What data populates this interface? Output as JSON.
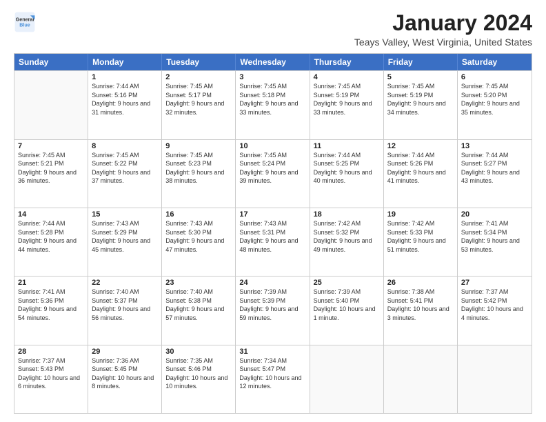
{
  "logo": {
    "line1": "General",
    "line2": "Blue"
  },
  "header": {
    "title": "January 2024",
    "location": "Teays Valley, West Virginia, United States"
  },
  "weekdays": [
    "Sunday",
    "Monday",
    "Tuesday",
    "Wednesday",
    "Thursday",
    "Friday",
    "Saturday"
  ],
  "weeks": [
    [
      {
        "day": "",
        "sunrise": "",
        "sunset": "",
        "daylight": ""
      },
      {
        "day": "1",
        "sunrise": "7:44 AM",
        "sunset": "5:16 PM",
        "daylight": "9 hours and 31 minutes."
      },
      {
        "day": "2",
        "sunrise": "7:45 AM",
        "sunset": "5:17 PM",
        "daylight": "9 hours and 32 minutes."
      },
      {
        "day": "3",
        "sunrise": "7:45 AM",
        "sunset": "5:18 PM",
        "daylight": "9 hours and 33 minutes."
      },
      {
        "day": "4",
        "sunrise": "7:45 AM",
        "sunset": "5:19 PM",
        "daylight": "9 hours and 33 minutes."
      },
      {
        "day": "5",
        "sunrise": "7:45 AM",
        "sunset": "5:19 PM",
        "daylight": "9 hours and 34 minutes."
      },
      {
        "day": "6",
        "sunrise": "7:45 AM",
        "sunset": "5:20 PM",
        "daylight": "9 hours and 35 minutes."
      }
    ],
    [
      {
        "day": "7",
        "sunrise": "7:45 AM",
        "sunset": "5:21 PM",
        "daylight": "9 hours and 36 minutes."
      },
      {
        "day": "8",
        "sunrise": "7:45 AM",
        "sunset": "5:22 PM",
        "daylight": "9 hours and 37 minutes."
      },
      {
        "day": "9",
        "sunrise": "7:45 AM",
        "sunset": "5:23 PM",
        "daylight": "9 hours and 38 minutes."
      },
      {
        "day": "10",
        "sunrise": "7:45 AM",
        "sunset": "5:24 PM",
        "daylight": "9 hours and 39 minutes."
      },
      {
        "day": "11",
        "sunrise": "7:44 AM",
        "sunset": "5:25 PM",
        "daylight": "9 hours and 40 minutes."
      },
      {
        "day": "12",
        "sunrise": "7:44 AM",
        "sunset": "5:26 PM",
        "daylight": "9 hours and 41 minutes."
      },
      {
        "day": "13",
        "sunrise": "7:44 AM",
        "sunset": "5:27 PM",
        "daylight": "9 hours and 43 minutes."
      }
    ],
    [
      {
        "day": "14",
        "sunrise": "7:44 AM",
        "sunset": "5:28 PM",
        "daylight": "9 hours and 44 minutes."
      },
      {
        "day": "15",
        "sunrise": "7:43 AM",
        "sunset": "5:29 PM",
        "daylight": "9 hours and 45 minutes."
      },
      {
        "day": "16",
        "sunrise": "7:43 AM",
        "sunset": "5:30 PM",
        "daylight": "9 hours and 47 minutes."
      },
      {
        "day": "17",
        "sunrise": "7:43 AM",
        "sunset": "5:31 PM",
        "daylight": "9 hours and 48 minutes."
      },
      {
        "day": "18",
        "sunrise": "7:42 AM",
        "sunset": "5:32 PM",
        "daylight": "9 hours and 49 minutes."
      },
      {
        "day": "19",
        "sunrise": "7:42 AM",
        "sunset": "5:33 PM",
        "daylight": "9 hours and 51 minutes."
      },
      {
        "day": "20",
        "sunrise": "7:41 AM",
        "sunset": "5:34 PM",
        "daylight": "9 hours and 53 minutes."
      }
    ],
    [
      {
        "day": "21",
        "sunrise": "7:41 AM",
        "sunset": "5:36 PM",
        "daylight": "9 hours and 54 minutes."
      },
      {
        "day": "22",
        "sunrise": "7:40 AM",
        "sunset": "5:37 PM",
        "daylight": "9 hours and 56 minutes."
      },
      {
        "day": "23",
        "sunrise": "7:40 AM",
        "sunset": "5:38 PM",
        "daylight": "9 hours and 57 minutes."
      },
      {
        "day": "24",
        "sunrise": "7:39 AM",
        "sunset": "5:39 PM",
        "daylight": "9 hours and 59 minutes."
      },
      {
        "day": "25",
        "sunrise": "7:39 AM",
        "sunset": "5:40 PM",
        "daylight": "10 hours and 1 minute."
      },
      {
        "day": "26",
        "sunrise": "7:38 AM",
        "sunset": "5:41 PM",
        "daylight": "10 hours and 3 minutes."
      },
      {
        "day": "27",
        "sunrise": "7:37 AM",
        "sunset": "5:42 PM",
        "daylight": "10 hours and 4 minutes."
      }
    ],
    [
      {
        "day": "28",
        "sunrise": "7:37 AM",
        "sunset": "5:43 PM",
        "daylight": "10 hours and 6 minutes."
      },
      {
        "day": "29",
        "sunrise": "7:36 AM",
        "sunset": "5:45 PM",
        "daylight": "10 hours and 8 minutes."
      },
      {
        "day": "30",
        "sunrise": "7:35 AM",
        "sunset": "5:46 PM",
        "daylight": "10 hours and 10 minutes."
      },
      {
        "day": "31",
        "sunrise": "7:34 AM",
        "sunset": "5:47 PM",
        "daylight": "10 hours and 12 minutes."
      },
      {
        "day": "",
        "sunrise": "",
        "sunset": "",
        "daylight": ""
      },
      {
        "day": "",
        "sunrise": "",
        "sunset": "",
        "daylight": ""
      },
      {
        "day": "",
        "sunrise": "",
        "sunset": "",
        "daylight": ""
      }
    ]
  ]
}
